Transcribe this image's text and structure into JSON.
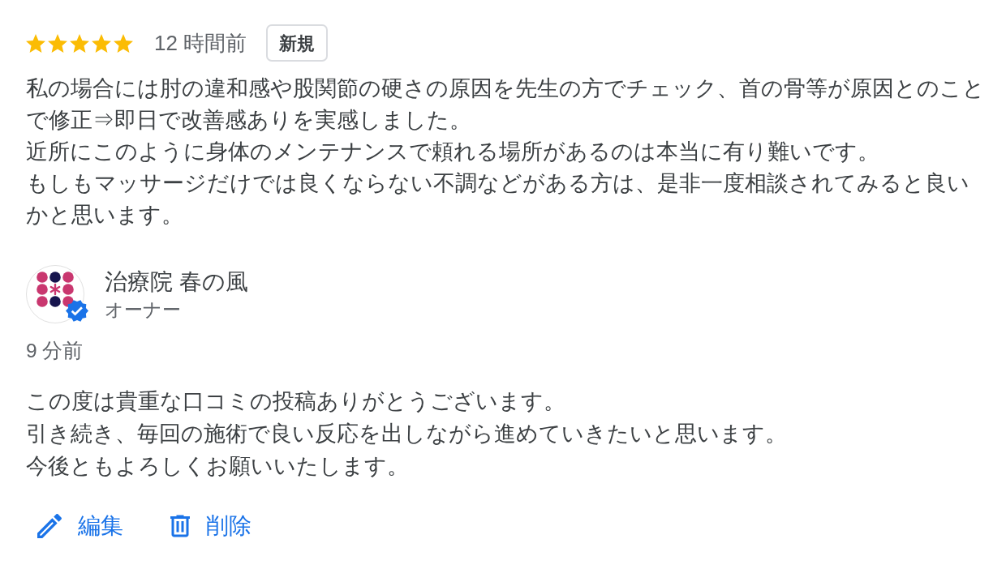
{
  "review": {
    "stars": 5,
    "time": "12 時間前",
    "tag": "新規",
    "paragraphs": [
      "私の場合には肘の違和感や股関節の硬さの原因を先生の方でチェック、首の骨等が原因とのことで修正⇒即日で改善感ありを実感しました。",
      "近所にこのように身体のメンテナンスで頼れる場所があるのは本当に有り難いです。",
      "もしもマッサージだけでは良くならない不調などがある方は、是非一度相談されてみると良いかと思います。"
    ]
  },
  "owner_reply": {
    "name": "治療院 春の風",
    "role": "オーナー",
    "verified": true,
    "time": "9 分前",
    "paragraphs": [
      "この度は貴重な口コミの投稿ありがとうございます。",
      "引き続き、毎回の施術で良い反応を出しながら進めていきたいと思います。",
      "今後ともよろしくお願いいたします。"
    ],
    "actions": [
      {
        "kind": "edit",
        "label": "編集"
      },
      {
        "kind": "delete",
        "label": "削除"
      }
    ]
  }
}
